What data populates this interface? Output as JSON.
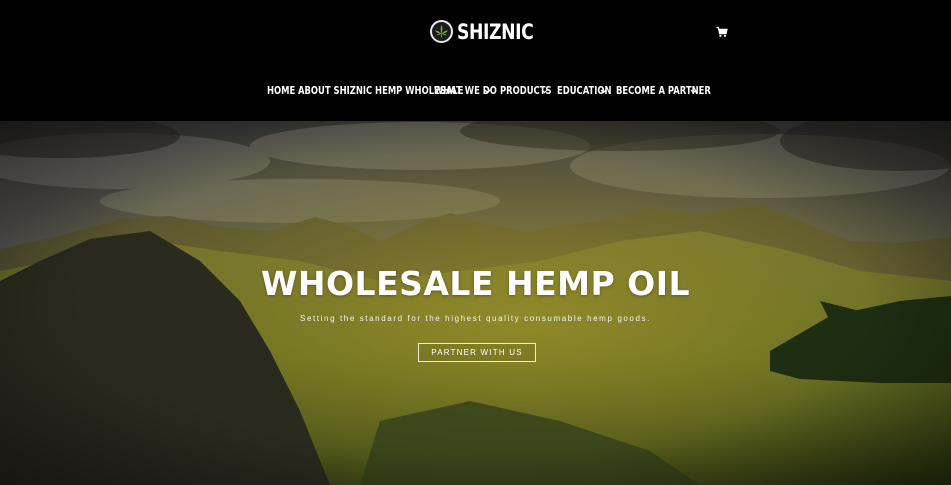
{
  "brand": {
    "name": "SHIZNIC",
    "logo_icon": "cannabis-leaf-icon",
    "accent": "#6a9a1f"
  },
  "header": {
    "cart_icon": "cart-icon"
  },
  "nav": {
    "items": [
      {
        "label": "HOME",
        "has_dropdown": false
      },
      {
        "label": "ABOUT SHIZNIC HEMP WHOLESALE",
        "has_dropdown": false
      },
      {
        "label": "WHAT WE DO",
        "has_dropdown": true
      },
      {
        "label": "PRODUCTS",
        "has_dropdown": true
      },
      {
        "label": "EDUCATION",
        "has_dropdown": true
      },
      {
        "label": "BECOME A PARTNER",
        "has_dropdown": true
      }
    ]
  },
  "hero": {
    "title": "WHOLESALE HEMP OIL",
    "subtitle": "Setting the standard for the highest quality consumable hemp goods.",
    "cta_label": "PARTNER WITH US",
    "background": "mountain-landscape-image"
  }
}
